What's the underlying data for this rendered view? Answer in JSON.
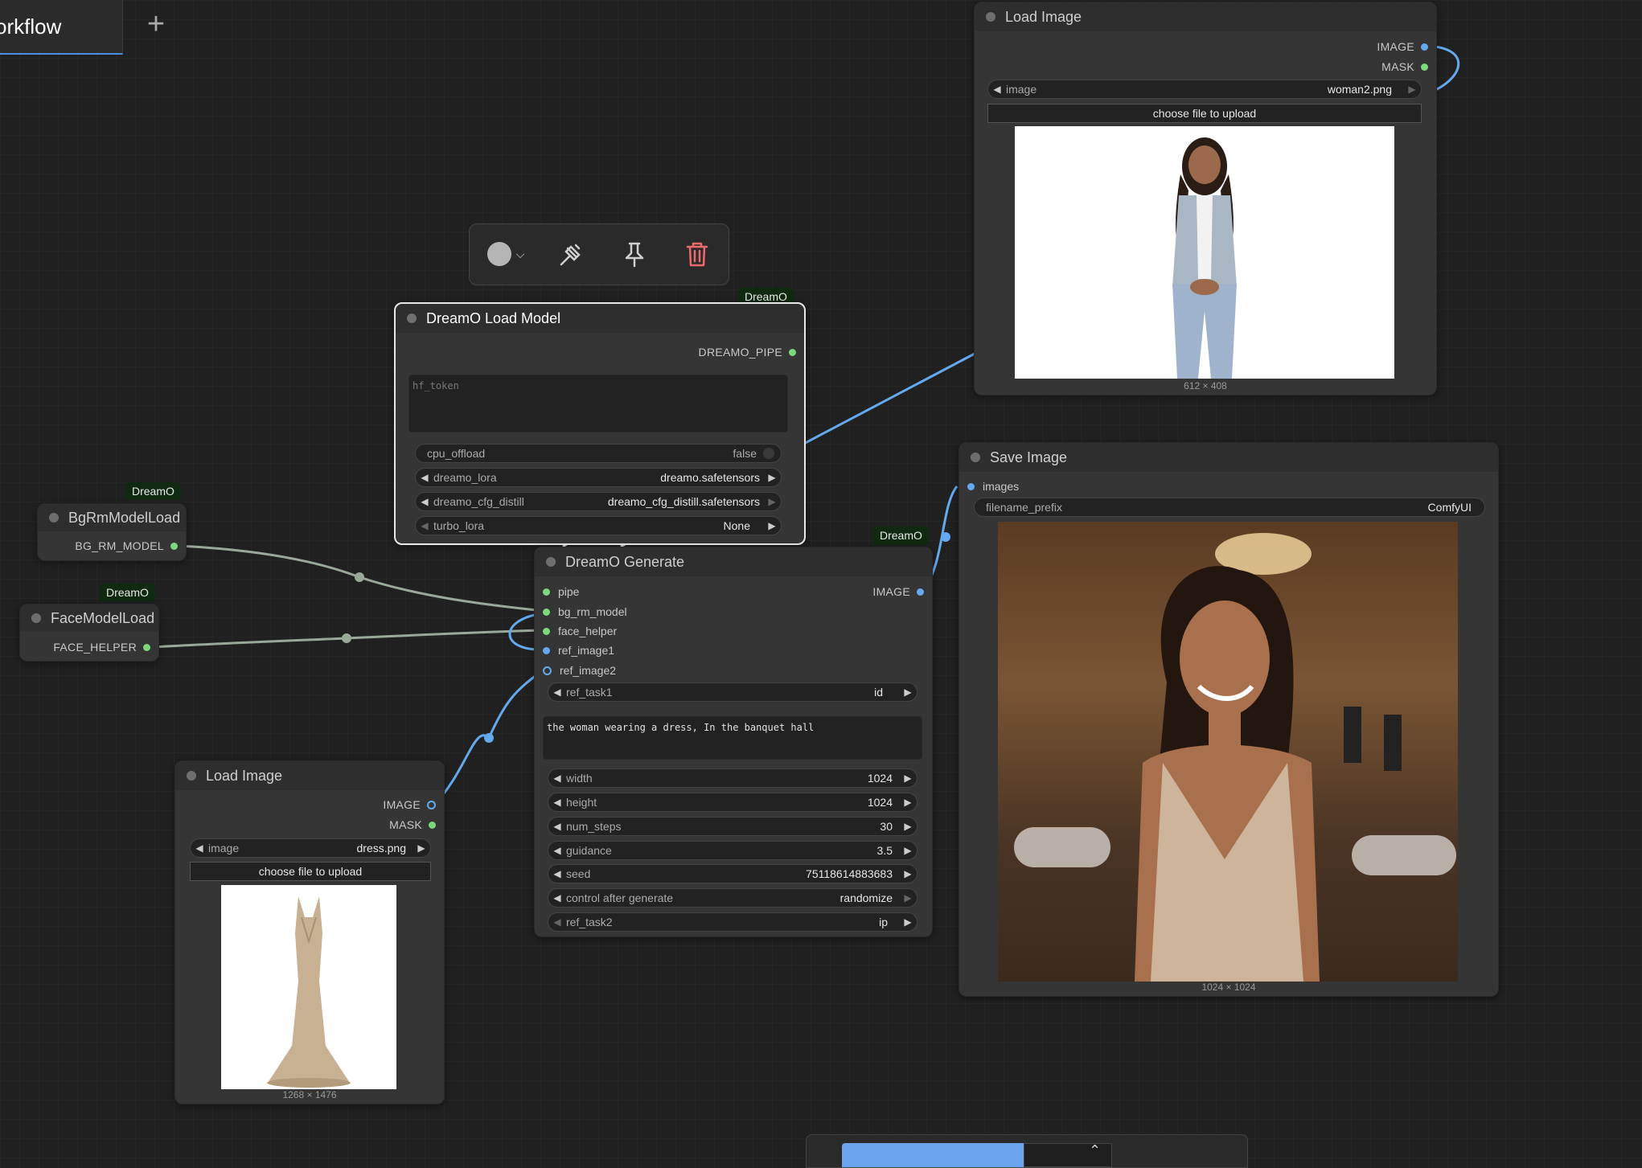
{
  "tab": {
    "title": "orkflow"
  },
  "toolbar": {
    "color_icon": "color-circle-icon",
    "bypass_icon": "bypass-icon",
    "pin_icon": "pin-icon",
    "delete_icon": "trash-icon"
  },
  "nodes": {
    "load_model": {
      "badge": "DreamO",
      "title": "DreamO Load Model",
      "output": "DREAMO_PIPE",
      "hf_token_placeholder": "hf_token",
      "cpu_offload_label": "cpu_offload",
      "cpu_offload_value": "false",
      "dreamo_lora_label": "dreamo_lora",
      "dreamo_lora_value": "dreamo.safetensors",
      "cfg_distill_label": "dreamo_cfg_distill",
      "cfg_distill_value": "dreamo_cfg_distill.safetensors",
      "turbo_lora_label": "turbo_lora",
      "turbo_lora_value": "None"
    },
    "bgrm": {
      "badge": "DreamO",
      "title": "BgRmModelLoad",
      "output": "BG_RM_MODEL"
    },
    "face": {
      "badge": "DreamO",
      "title": "FaceModelLoad",
      "output": "FACE_HELPER"
    },
    "generate": {
      "badge": "DreamO",
      "title": "DreamO Generate",
      "inputs": [
        "pipe",
        "bg_rm_model",
        "face_helper",
        "ref_image1",
        "ref_image2"
      ],
      "output": "IMAGE",
      "ref_task1_label": "ref_task1",
      "ref_task1_value": "id",
      "prompt": "the woman wearing a dress, In the banquet hall",
      "width_label": "width",
      "width_value": "1024",
      "height_label": "height",
      "height_value": "1024",
      "steps_label": "num_steps",
      "steps_value": "30",
      "guidance_label": "guidance",
      "guidance_value": "3.5",
      "seed_label": "seed",
      "seed_value": "75118614883683",
      "control_label": "control after generate",
      "control_value": "randomize",
      "ref_task2_label": "ref_task2",
      "ref_task2_value": "ip"
    },
    "load_image_top": {
      "title": "Load Image",
      "out_image": "IMAGE",
      "out_mask": "MASK",
      "image_label": "image",
      "image_value": "woman2.png",
      "upload": "choose file to upload",
      "dims": "612 × 408"
    },
    "load_image_bottom": {
      "title": "Load Image",
      "out_image": "IMAGE",
      "out_mask": "MASK",
      "image_label": "image",
      "image_value": "dress.png",
      "upload": "choose file to upload",
      "dims": "1268 × 1476"
    },
    "save_image": {
      "title": "Save Image",
      "input": "images",
      "prefix_label": "filename_prefix",
      "prefix_value": "ComfyUI",
      "dims": "1024 × 1024"
    }
  }
}
